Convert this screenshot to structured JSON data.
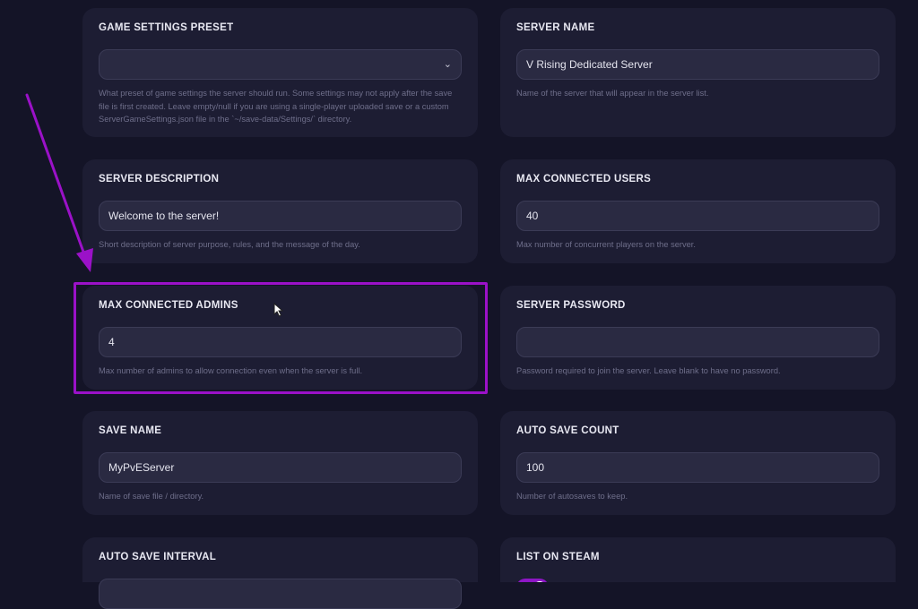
{
  "cards": {
    "game_settings_preset": {
      "label": "GAME SETTINGS PRESET",
      "value": "",
      "description": "What preset of game settings the server should run. Some settings may not apply after the save file is first created. Leave empty/null if you are using a single-player uploaded save or a custom ServerGameSettings.json file in the `~/save-data/Settings/` directory."
    },
    "server_name": {
      "label": "SERVER NAME",
      "value": "V Rising Dedicated Server",
      "description": "Name of the server that will appear in the server list."
    },
    "server_description": {
      "label": "SERVER DESCRIPTION",
      "value": "Welcome to the server!",
      "description": "Short description of server purpose, rules, and the message of the day."
    },
    "max_connected_users": {
      "label": "MAX CONNECTED USERS",
      "value": "40",
      "description": "Max number of concurrent players on the server."
    },
    "max_connected_admins": {
      "label": "MAX CONNECTED ADMINS",
      "value": "4",
      "description": "Max number of admins to allow connection even when the server is full."
    },
    "server_password": {
      "label": "SERVER PASSWORD",
      "value": "",
      "description": "Password required to join the server. Leave blank to have no password."
    },
    "save_name": {
      "label": "SAVE NAME",
      "value": "MyPvEServer",
      "description": "Name of save file / directory."
    },
    "auto_save_count": {
      "label": "AUTO SAVE COUNT",
      "value": "100",
      "description": "Number of autosaves to keep."
    },
    "auto_save_interval": {
      "label": "AUTO SAVE INTERVAL"
    },
    "list_on_steam": {
      "label": "LIST ON STEAM",
      "enabled": true
    }
  },
  "colors": {
    "background": "#141427",
    "card": "#1d1d33",
    "accent": "#9b11c8"
  }
}
